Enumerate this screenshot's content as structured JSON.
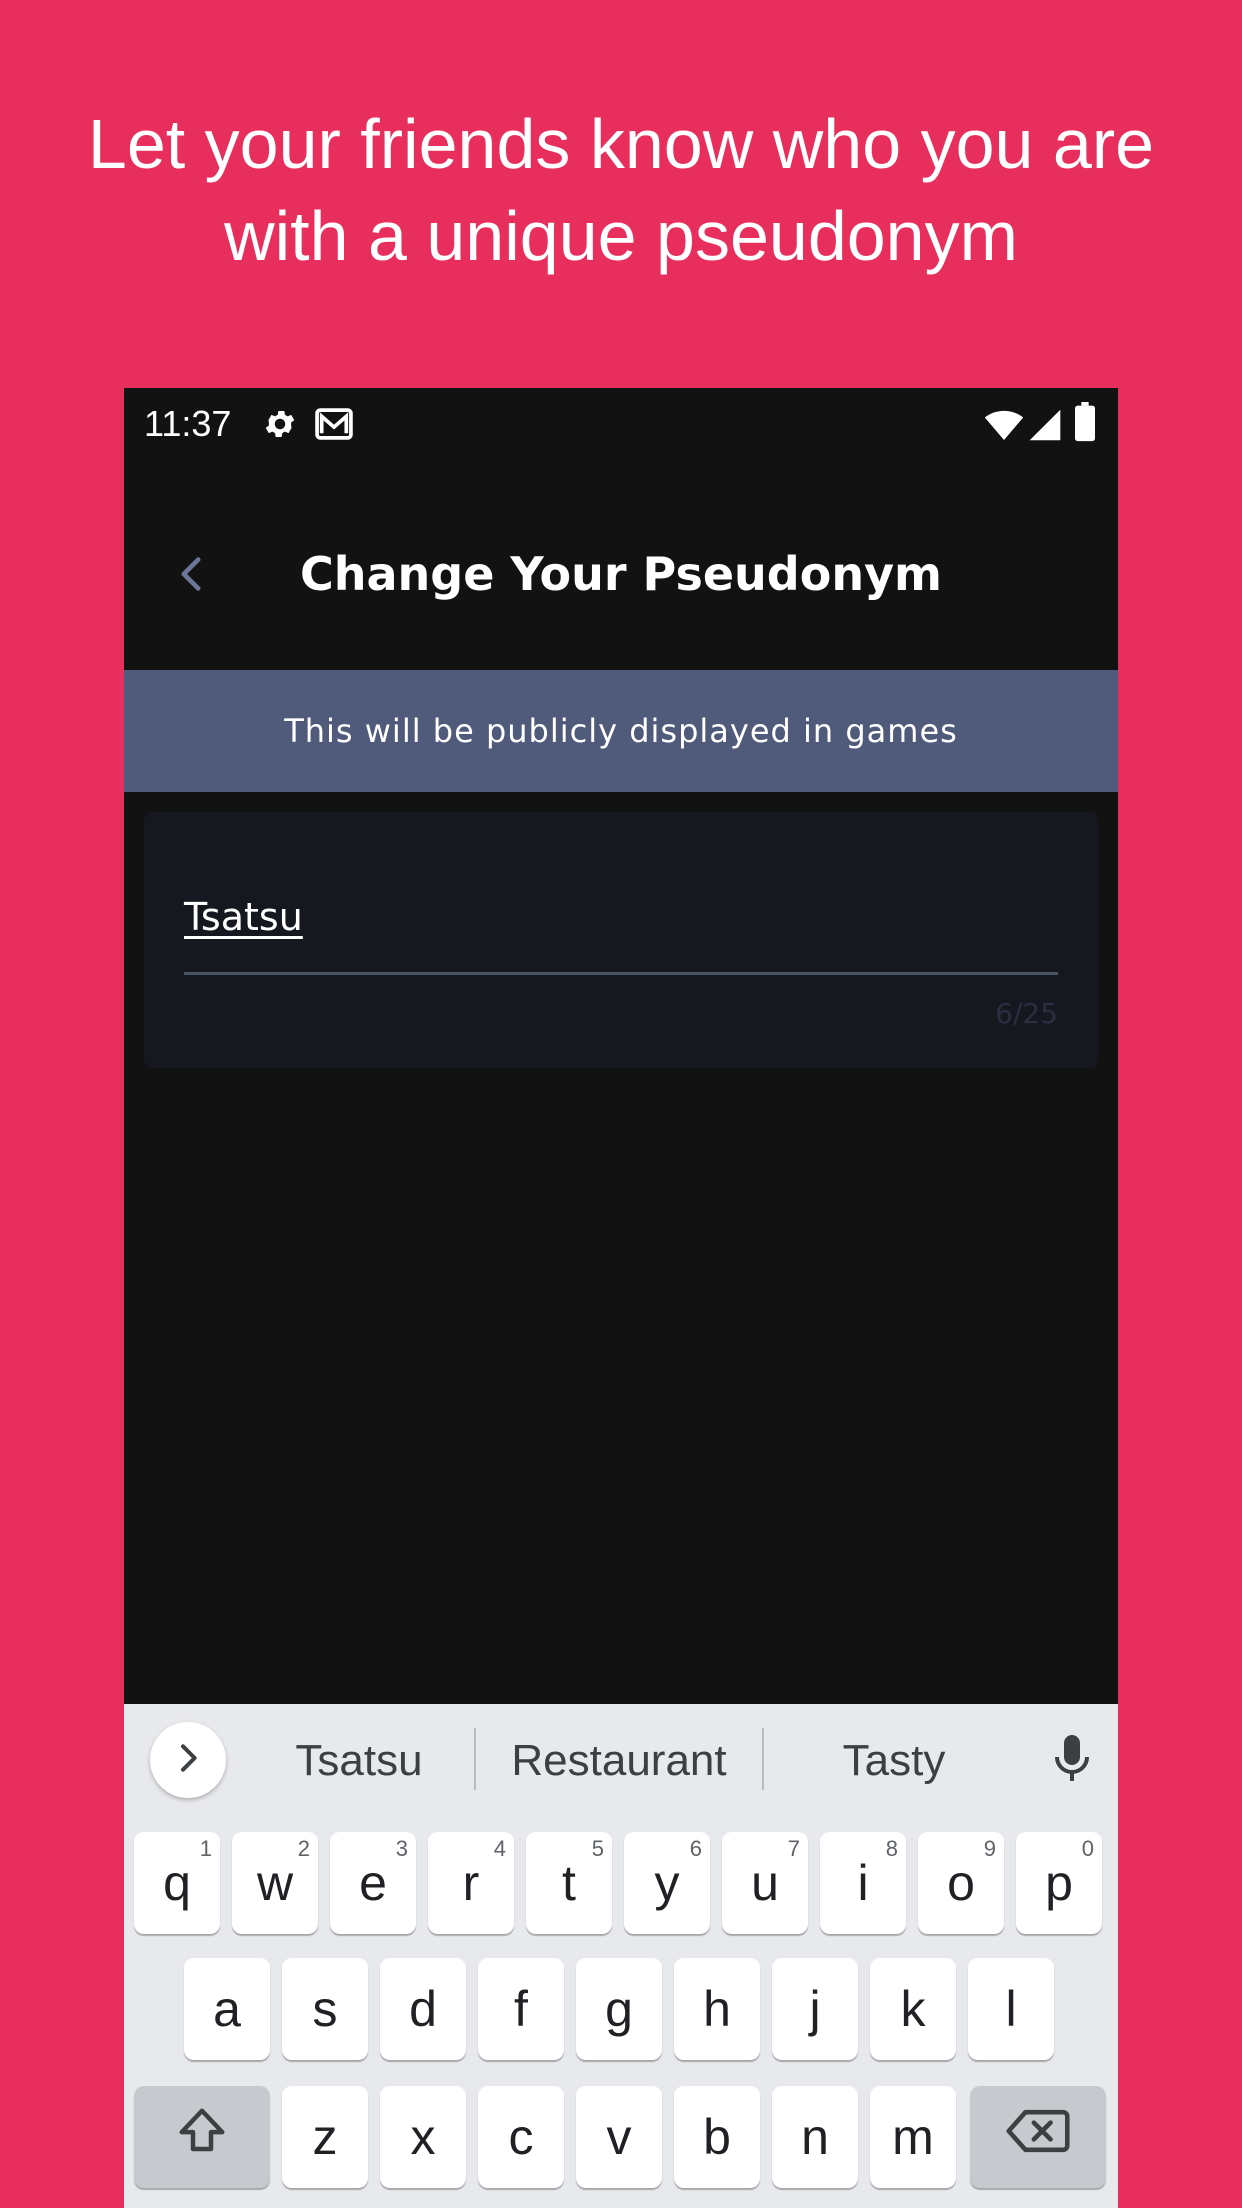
{
  "promo": {
    "line1": "Let your friends know who you are",
    "line2": "with a unique pseudonym"
  },
  "status_bar": {
    "time": "11:37",
    "left_icons": [
      "gear-icon",
      "gmail-icon"
    ],
    "right_icons": [
      "wifi-icon",
      "signal-icon",
      "battery-icon"
    ]
  },
  "header": {
    "back_icon": "chevron-left-icon",
    "title": "Change Your Pseudonym"
  },
  "banner": {
    "text": "This will be publicly displayed in games"
  },
  "pseudonym_field": {
    "value": "Tsatsu",
    "counter": "6/25"
  },
  "keyboard": {
    "suggestions": [
      "Tsatsu",
      "Restaurant",
      "Tasty"
    ],
    "row1": [
      {
        "label": "q",
        "num": "1"
      },
      {
        "label": "w",
        "num": "2"
      },
      {
        "label": "e",
        "num": "3"
      },
      {
        "label": "r",
        "num": "4"
      },
      {
        "label": "t",
        "num": "5"
      },
      {
        "label": "y",
        "num": "6"
      },
      {
        "label": "u",
        "num": "7"
      },
      {
        "label": "i",
        "num": "8"
      },
      {
        "label": "o",
        "num": "9"
      },
      {
        "label": "p",
        "num": "0"
      }
    ],
    "row2": [
      "a",
      "s",
      "d",
      "f",
      "g",
      "h",
      "j",
      "k",
      "l"
    ],
    "row3": [
      "z",
      "x",
      "c",
      "v",
      "b",
      "n",
      "m"
    ]
  },
  "colors": {
    "background": "#e82e5d",
    "app_background": "#121212",
    "banner": "#505a7b",
    "field_background": "#161820",
    "keyboard_background": "#e8e9ed"
  }
}
